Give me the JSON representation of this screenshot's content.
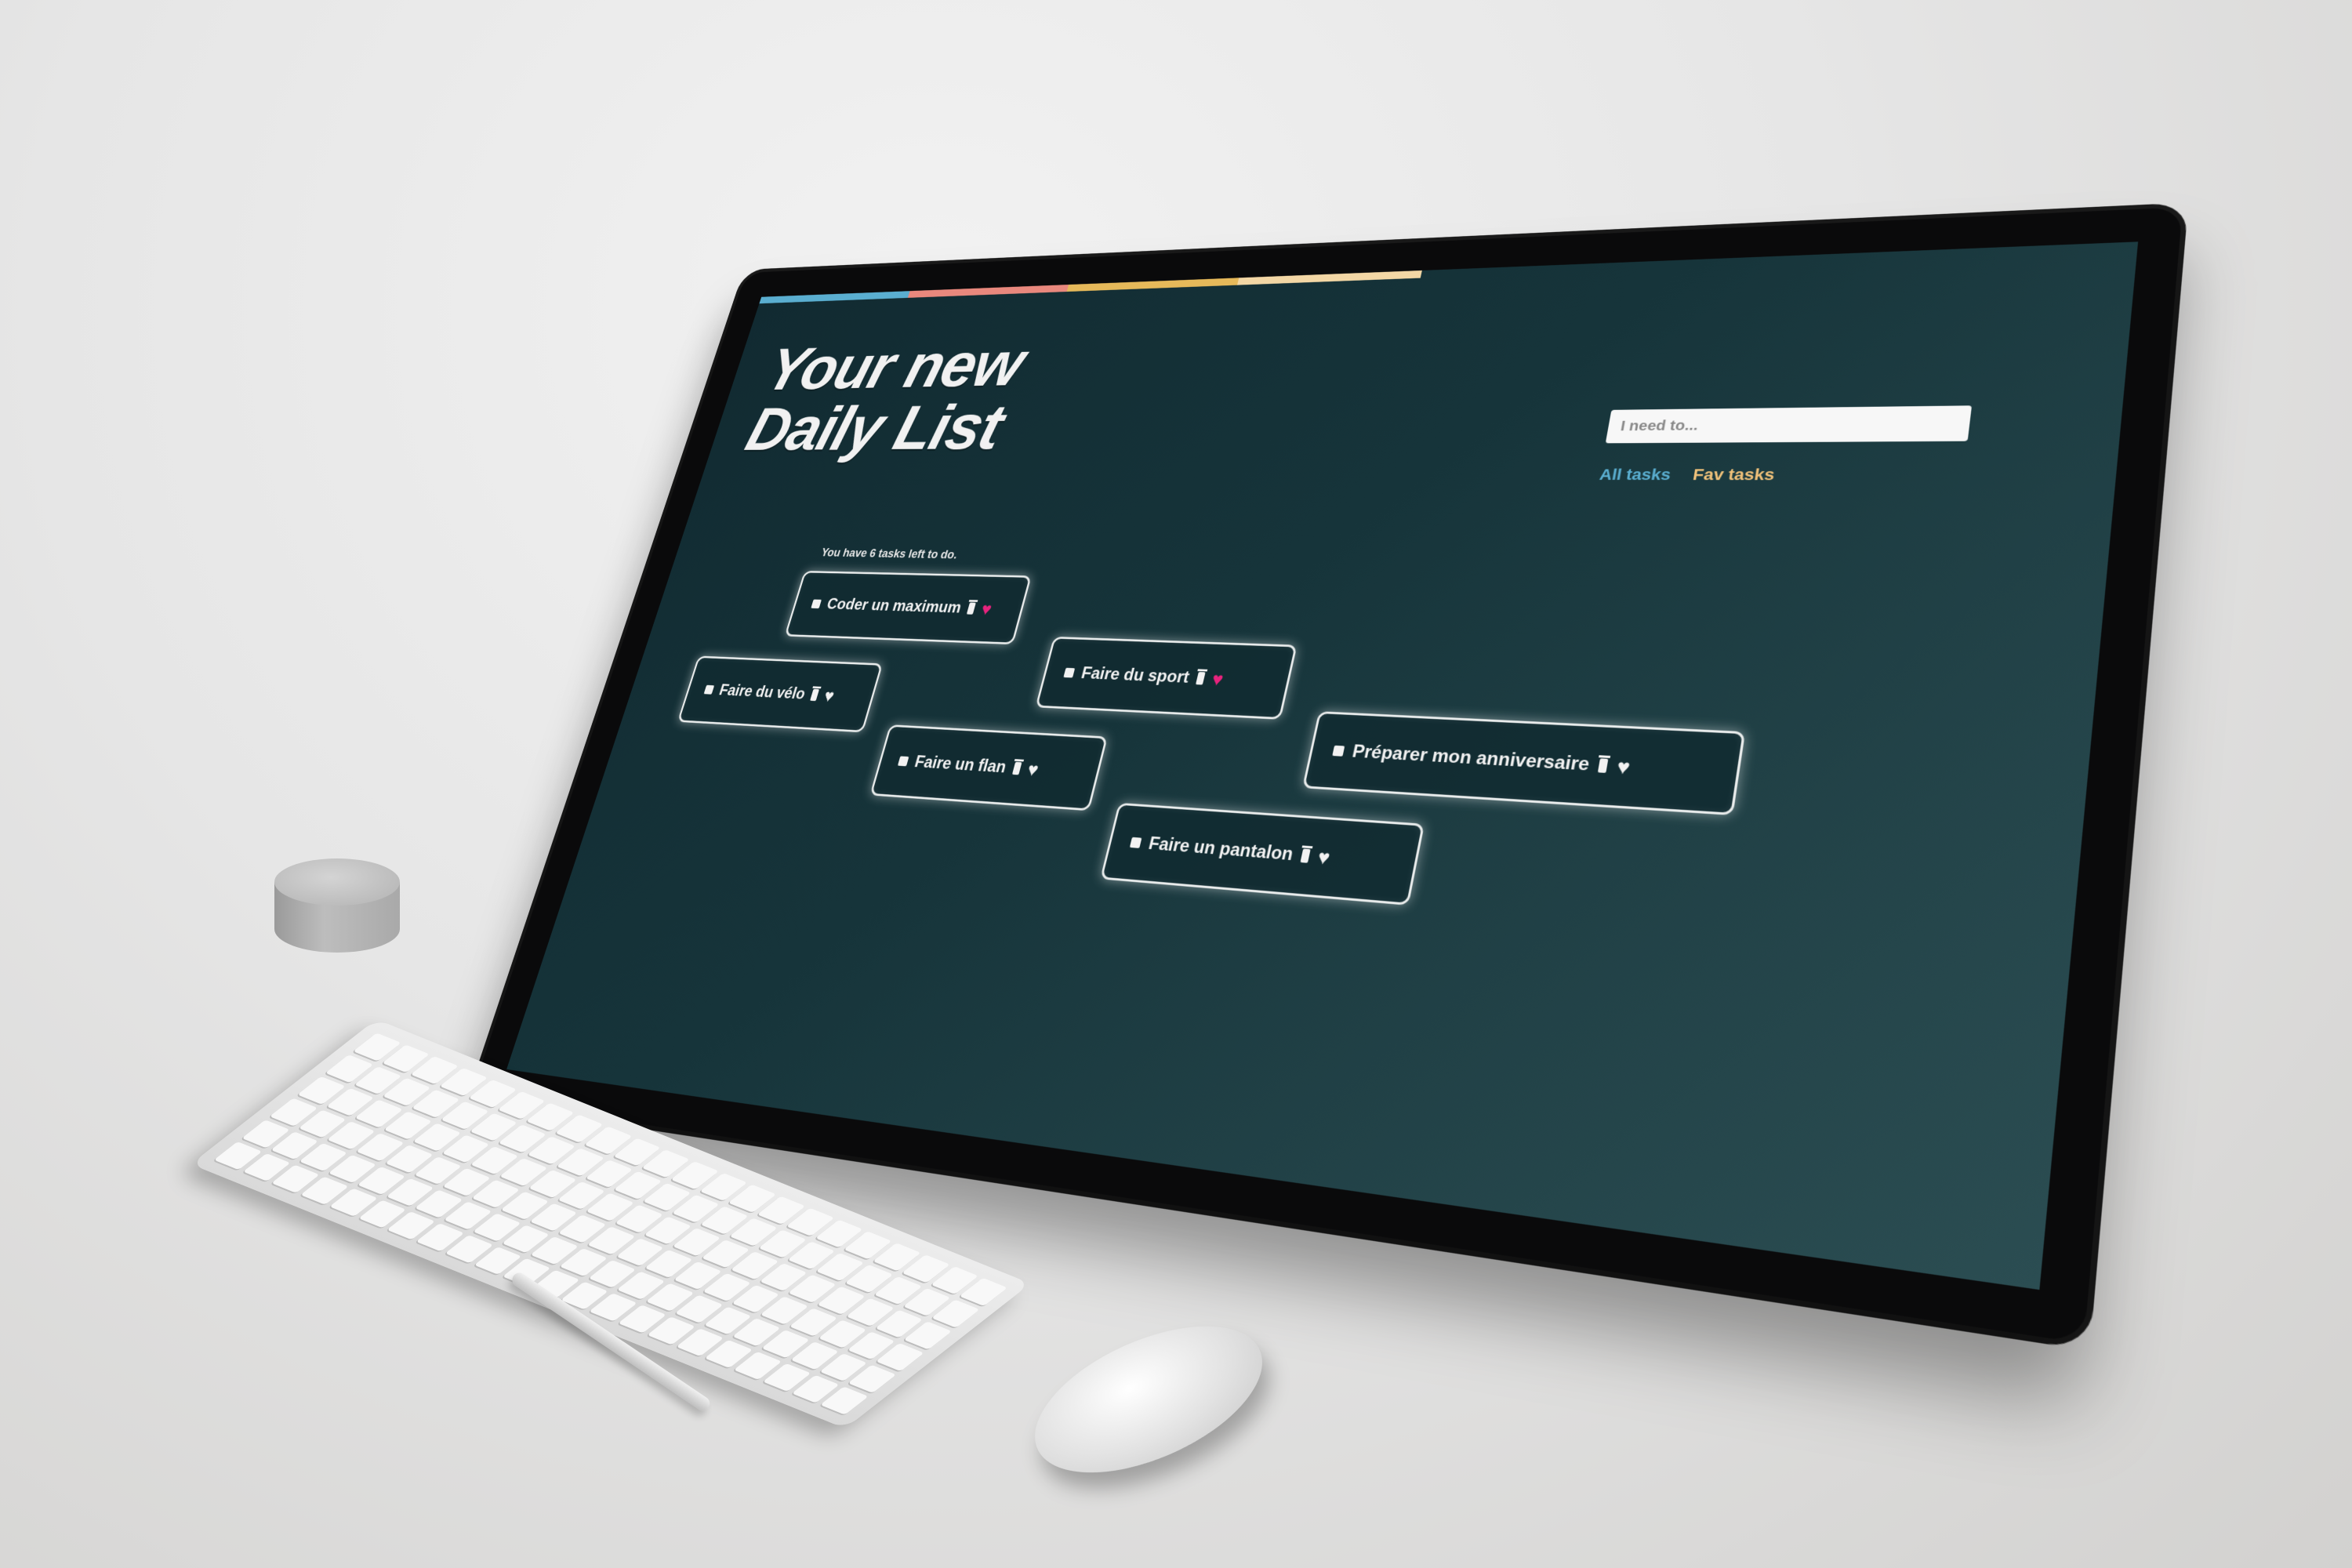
{
  "app": {
    "title_line1": "Your new",
    "title_line2": "Daily List"
  },
  "colors": {
    "accent_bar": [
      "#5aaed0",
      "#e9887d",
      "#e6b95a",
      "#f3d7a5"
    ],
    "fav_heart": "#e8237d",
    "all_tasks_link": "#5aaed0",
    "fav_tasks_link": "#f1c27a"
  },
  "search": {
    "placeholder": "I need to...",
    "value": ""
  },
  "filters": {
    "all_label": "All tasks",
    "fav_label": "Fav tasks"
  },
  "status": {
    "remaining_text": "You have 6 tasks left to do."
  },
  "tasks": [
    {
      "label": "Coder un maximum",
      "favorite": true,
      "icons": [
        "checkbox-icon",
        "trash-icon",
        "heart-icon"
      ]
    },
    {
      "label": "Faire du sport",
      "favorite": true,
      "icons": [
        "checkbox-icon",
        "trash-icon",
        "heart-icon"
      ]
    },
    {
      "label": "Faire du vélo",
      "favorite": false,
      "icons": [
        "checkbox-icon",
        "trash-icon",
        "heart-icon"
      ]
    },
    {
      "label": "Faire un flan",
      "favorite": false,
      "icons": [
        "checkbox-icon",
        "trash-icon",
        "heart-icon"
      ]
    },
    {
      "label": "Préparer mon anniversaire",
      "favorite": false,
      "icons": [
        "checkbox-icon",
        "trash-icon",
        "heart-icon"
      ]
    },
    {
      "label": "Faire un pantalon",
      "favorite": false,
      "icons": [
        "checkbox-icon",
        "trash-icon",
        "heart-icon"
      ]
    }
  ]
}
